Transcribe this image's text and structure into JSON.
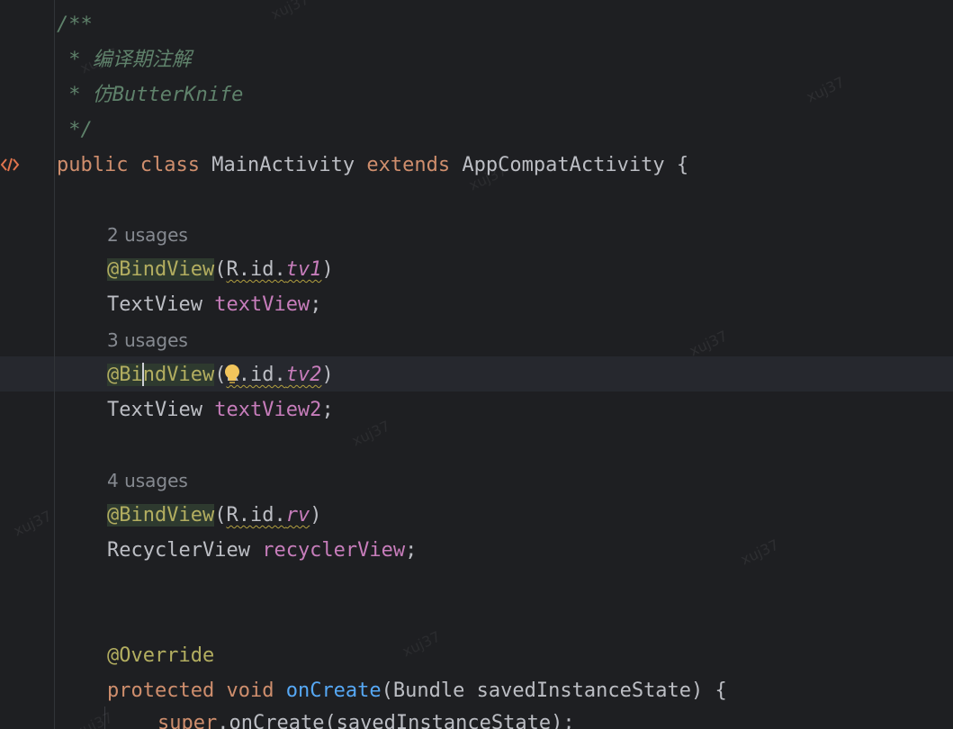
{
  "editor": {
    "doc_comment": {
      "open": "/**",
      "line1": " * 编译期注解",
      "line2": " * 仿ButterKnife",
      "close": " */"
    },
    "class_decl": {
      "kw_public": "public",
      "kw_class": "class",
      "name": "MainActivity",
      "kw_extends": "extends",
      "parent": "AppCompatActivity",
      "brace": "{"
    },
    "usages": [
      "2 usages",
      "3 usages",
      "4 usages"
    ],
    "fields": [
      {
        "annotation": "@BindView",
        "paren_open": "(",
        "ref_prefix": "R.id.",
        "ref_id": "tv1",
        "paren_close": ")",
        "type": "TextView",
        "name": "textView",
        "semicolon": ";"
      },
      {
        "annotation_a": "@Bi",
        "annotation_b": "ndView",
        "paren_open": "(",
        "ref_prefix": "R.id.",
        "ref_id": "tv2",
        "paren_close": ")",
        "type": "TextView",
        "name": "textView2",
        "semicolon": ";"
      },
      {
        "annotation": "@BindView",
        "paren_open": "(",
        "ref_prefix": "R.id.",
        "ref_id": "rv",
        "paren_close": ")",
        "type": "RecyclerView",
        "name": "recyclerView",
        "semicolon": ";"
      }
    ],
    "override": {
      "annotation": "@Override",
      "kw_protected": "protected",
      "kw_void": "void",
      "method": "onCreate",
      "params": "(Bundle savedInstanceState) {",
      "super_kw": "super",
      "super_call": ".onCreate(savedInstanceState);"
    },
    "gutter_icon": "html-tag-icon",
    "watermark_text": "xuj37",
    "colors": {
      "background": "#1e1f22",
      "keyword": "#cf8e6d",
      "annotation": "#b3ae60",
      "field": "#c77dbb",
      "doc_comment": "#5f826b",
      "method": "#56a8f5",
      "text": "#bcbec4"
    }
  }
}
